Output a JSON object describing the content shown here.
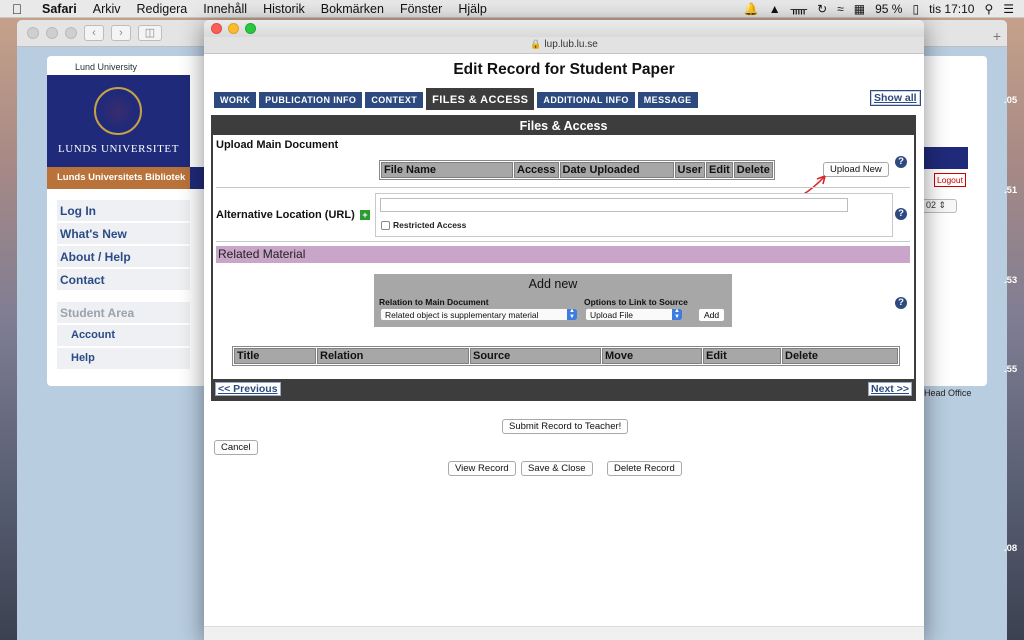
{
  "menubar": {
    "apple": "",
    "items": [
      "Safari",
      "Arkiv",
      "Redigera",
      "Innehåll",
      "Historik",
      "Bokmärken",
      "Fönster",
      "Hjälp"
    ],
    "battery": "95 %",
    "clock": "tis 17:10"
  },
  "background_window": {
    "lu_small": "Lund University",
    "lu_name": "LUNDS UNIVERSITET",
    "library": "Lunds Universitets Bibliotek",
    "nav": [
      "Log In",
      "What's New",
      "About / Help",
      "Contact"
    ],
    "student_area": "Student Area",
    "student_items": [
      "Account",
      "Help"
    ],
    "logout": "Logout",
    "select_value": "02",
    "head_office": "Head Office",
    "edge_numbers": [
      ".05",
      ".51",
      ".53",
      ".55",
      ".08"
    ]
  },
  "popup": {
    "url": "lup.lub.lu.se",
    "title": "Edit Record for Student Paper",
    "tabs": [
      "WORK",
      "PUBLICATION INFO",
      "CONTEXT",
      "FILES & ACCESS",
      "ADDITIONAL INFO",
      "MESSAGE"
    ],
    "active_tab": "FILES & ACCESS",
    "show_all": "Show all",
    "panel_title": "Files & Access",
    "upload_main_label": "Upload Main Document",
    "files_columns": [
      "File Name",
      "Access",
      "Date Uploaded",
      "User",
      "Edit",
      "Delete"
    ],
    "upload_new": "Upload New",
    "help_glyph": "?",
    "alt_location_label": "Alternative Location (URL)",
    "alt_plus": "+",
    "restricted_access": "Restricted Access",
    "related_material": "Related Material",
    "add_new": {
      "title": "Add new",
      "relation_label": "Relation to Main Document",
      "relation_value": "Related object is supplementary material",
      "options_label": "Options to Link to Source",
      "options_value": "Upload File",
      "add_button": "Add"
    },
    "related_columns": [
      "Title",
      "Relation",
      "Source",
      "Move",
      "Edit",
      "Delete"
    ],
    "previous": "<< Previous",
    "next": "Next >>",
    "submit": "Submit Record to Teacher!",
    "cancel": "Cancel",
    "view_record": "View Record",
    "save_close": "Save & Close",
    "delete_record": "Delete Record"
  },
  "colors": {
    "tab_blue": "#2c4a7f",
    "dark_header": "#3d3d3d",
    "related_bar": "#c9a6c9",
    "lu_blue": "#1f2a7a",
    "library_orange": "#b8723a",
    "arrow_red": "#d8262e"
  }
}
